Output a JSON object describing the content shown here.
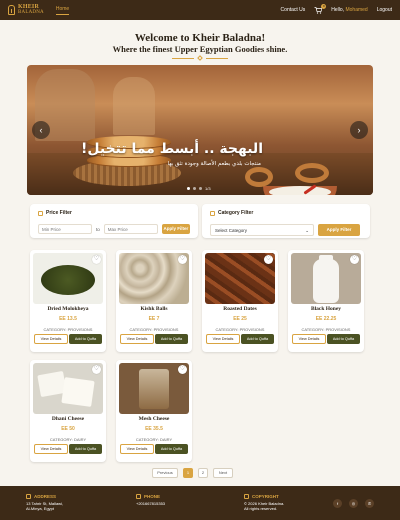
{
  "nav": {
    "brand_line1": "KHEIR",
    "brand_line2": "BALADNA",
    "home": "Home",
    "contact": "Contact Us",
    "cart_count": "0",
    "hello": "Hello,",
    "user_name": "Mohamed",
    "logout": "Logout"
  },
  "heading": {
    "title": "Welcome to Kheir Baladna!",
    "subtitle": "Where the finest Upper Egyptian Goodies shine."
  },
  "hero": {
    "title": "البهجة .. أبسط مما تتخيل!",
    "subtitle": "منتجات بلدي بطعم الأصالة وجودة تثق بها",
    "counter": "1/3",
    "prev": "‹",
    "next": "›"
  },
  "price_filter": {
    "title": "Price Filter",
    "min_placeholder": "Min Price",
    "to": "to",
    "max_placeholder": "Max Price",
    "button": "Apply Filter"
  },
  "category_filter": {
    "title": "Category Filter",
    "selected": "Select Category",
    "button": "Apply Filter"
  },
  "products": [
    {
      "name": "Dried Molokheya",
      "price": "EE 13.5",
      "category": "CATEGORY: PROVISIONS"
    },
    {
      "name": "Kishk Balls",
      "price": "EE 7",
      "category": "CATEGORY: PROVISIONS"
    },
    {
      "name": "Roasted Dates",
      "price": "EE 25",
      "category": "CATEGORY: PROVISIONS"
    },
    {
      "name": "Black Honey",
      "price": "EE 22.25",
      "category": "CATEGORY: PROVISIONS"
    },
    {
      "name": "Dhani Cheese",
      "price": "EE 50",
      "category": "CATEGORY: DAIRY"
    },
    {
      "name": "Mesh Cheese",
      "price": "EE 35.5",
      "category": "CATEGORY: DAIRY"
    }
  ],
  "card_buttons": {
    "view": "View Details",
    "add": "Add to Quffa"
  },
  "pagination": {
    "previous": "Previous",
    "page1": "1",
    "page2": "2",
    "next": "Next"
  },
  "footer": {
    "address_title": "ADDRESS",
    "address_line1": "13 Tahrir St, Mallawi,",
    "address_line2": "Al-Minya, Egypt",
    "phone_title": "PHONE",
    "phone": "+201667815353",
    "copyright_title": "COPYRIGHT",
    "copyright_line1": "© 2026 Kheir Baladna.",
    "copyright_line2": "All rights reserved."
  },
  "colors": {
    "brown": "#3d2a17",
    "gold": "#d9a441",
    "olive": "#4b5223"
  }
}
